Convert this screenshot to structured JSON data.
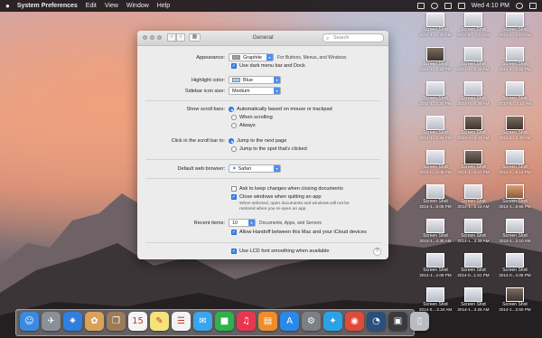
{
  "colors": {
    "menubar": "#1c181a",
    "accent": "#3d86ef",
    "window_bg": "#ececec"
  },
  "menubar": {
    "app_name": "System Preferences",
    "menus": [
      "Edit",
      "View",
      "Window",
      "Help"
    ],
    "clock": "Wed 4:10 PM",
    "icons": [
      "bluetooth-icon",
      "wifi-icon",
      "volume-icon",
      "battery-icon",
      "spotlight-icon",
      "notification-icon"
    ]
  },
  "window": {
    "title": "General",
    "search_placeholder": "Search",
    "appearance": {
      "label": "Appearance:",
      "value": "Graphite",
      "note": "For Buttons, Menus, and Windows"
    },
    "dark_menu": {
      "label": "Use dark menu bar and Dock",
      "checked": true
    },
    "highlight": {
      "label": "Highlight color:",
      "value": "Blue"
    },
    "sidebar_icon": {
      "label": "Sidebar icon size:",
      "value": "Medium"
    },
    "scroll_bars": {
      "label": "Show scroll bars:",
      "options": [
        "Automatically based on mouse or trackpad",
        "When scrolling",
        "Always"
      ],
      "selected": 0
    },
    "click_scroll": {
      "label": "Click in the scroll bar to:",
      "options": [
        "Jump to the next page",
        "Jump to the spot that's clicked"
      ],
      "selected": 0
    },
    "browser": {
      "label": "Default web browser:",
      "value": "Safari"
    },
    "ask_changes": {
      "label": "Ask to keep changes when closing documents",
      "checked": false
    },
    "close_windows": {
      "label": "Close windows when quitting an app",
      "checked": true,
      "note": "When selected, open documents and windows will not be restored when you re-open an app."
    },
    "recent": {
      "label": "Recent items:",
      "value": "10",
      "suffix": "Documents, Apps, and Servers"
    },
    "handoff": {
      "label": "Allow Handoff between this Mac and your iCloud devices",
      "checked": true
    },
    "lcd": {
      "label": "Use LCD font smoothing when available",
      "checked": true
    },
    "help": "?"
  },
  "desktop_icons": [
    {
      "t1": "Screen Shot",
      "t2": "2014-1...1.26 AM",
      "style": "light"
    },
    {
      "t1": "Screen Shot",
      "t2": "2014-0....7.11 AM",
      "style": "light"
    },
    {
      "t1": "Screen Shot",
      "t2": "2014-1...1.10 AM",
      "style": "light"
    },
    {
      "t1": "Screen Shot",
      "t2": "2014-1...3.23 PM",
      "style": "dark"
    },
    {
      "t1": "Screen Shot",
      "t2": "2014-1...5.46 AM",
      "style": "light"
    },
    {
      "t1": "Screen Shot",
      "t2": "2014-1...8.20 PM",
      "style": "light"
    },
    {
      "t1": "Screen Shot",
      "t2": "2014-1...2.34 PM",
      "style": "light"
    },
    {
      "t1": "Screen Shot",
      "t2": "2014-0...6.39 AM",
      "style": "light"
    },
    {
      "t1": "Screen Shot",
      "t2": "2014-0....3.14 AM",
      "style": "light"
    },
    {
      "t1": "Screen Shot",
      "t2": "2014-1...2.34 PM",
      "style": "light"
    },
    {
      "t1": "Screen Shot",
      "t2": "2014-0...4.40 AM",
      "style": "dark"
    },
    {
      "t1": "Screen Shot",
      "t2": "2014-1...3.40 AM",
      "style": "dark"
    },
    {
      "t1": "Screen Shot",
      "t2": "2014-0...6.05 PM",
      "style": "light"
    },
    {
      "t1": "Screen Shot",
      "t2": "2014-1...6.07 PM",
      "style": "dark"
    },
    {
      "t1": "Screen Shot",
      "t2": "2014-0...9.19 PM",
      "style": "light"
    },
    {
      "t1": "Screen Shot",
      "t2": "2014-1...6.05 PM",
      "style": "light"
    },
    {
      "t1": "Screen Shot",
      "t2": "2014-1...5.15 AM",
      "style": "light"
    },
    {
      "t1": "Screen Shot",
      "t2": "2014-1...8.55 PM",
      "style": "warm"
    },
    {
      "t1": "Screen Shot",
      "t2": "2014-1...4.35 AM",
      "style": "light"
    },
    {
      "t1": "Screen Shot",
      "t2": "2014-1...3.26 AM",
      "style": "light"
    },
    {
      "t1": "Screen Shot",
      "t2": "2014-1...3.10 AM",
      "style": "light"
    },
    {
      "t1": "Screen Shot",
      "t2": "2014-1...4.06 PM",
      "style": "light"
    },
    {
      "t1": "Screen Shot",
      "t2": "2014-0...1.51 PM",
      "style": "light"
    },
    {
      "t1": "Screen Shot",
      "t2": "2014-0...4.06 PM",
      "style": "light"
    },
    {
      "t1": "Screen Shot",
      "t2": "2014-0....2.34 AM",
      "style": "light"
    },
    {
      "t1": "Screen Shot",
      "t2": "2014-1...3.26 AM",
      "style": "light"
    },
    {
      "t1": "Screen Shot",
      "t2": "2014-1...3.50 PM",
      "style": "dark"
    }
  ],
  "dock": {
    "apps": [
      {
        "name": "finder-icon",
        "glyph": "☺",
        "color": "#3a8be0"
      },
      {
        "name": "launchpad-icon",
        "glyph": "✈",
        "color": "#8a8f99"
      },
      {
        "name": "safari-icon",
        "glyph": "✷",
        "color": "#2f7fe0"
      },
      {
        "name": "photos-icon",
        "glyph": "✿",
        "color": "#d9a15a"
      },
      {
        "name": "contacts-icon",
        "glyph": "❐",
        "color": "#9d7a58"
      },
      {
        "name": "calendar-icon",
        "glyph": "15",
        "color": "#f4f4f4"
      },
      {
        "name": "notes-icon",
        "glyph": "✎",
        "color": "#f6e27a"
      },
      {
        "name": "reminders-icon",
        "glyph": "☰",
        "color": "#f2f2f2"
      },
      {
        "name": "messages-icon",
        "glyph": "✉",
        "color": "#3aa4ec"
      },
      {
        "name": "facetime-icon",
        "glyph": "■",
        "color": "#2fb24c"
      },
      {
        "name": "itunes-icon",
        "glyph": "♫",
        "color": "#e8364f"
      },
      {
        "name": "ibooks-icon",
        "glyph": "▤",
        "color": "#f08c2a"
      },
      {
        "name": "app-store-icon",
        "glyph": "A",
        "color": "#2a88e8"
      },
      {
        "name": "system-preferences-icon",
        "glyph": "⚙",
        "color": "#7d7f86"
      },
      {
        "name": "twitter-icon",
        "glyph": "✦",
        "color": "#2aa3e6"
      },
      {
        "name": "chrome-icon",
        "glyph": "◉",
        "color": "#e04a3a"
      },
      {
        "name": "quicktime-icon",
        "glyph": "◔",
        "color": "#2a4f7c"
      },
      {
        "name": "downloads-icon",
        "glyph": "▣",
        "color": "#3a3a3f"
      },
      {
        "name": "trash-icon",
        "glyph": "▯",
        "color": "#b9bcc2"
      }
    ]
  }
}
